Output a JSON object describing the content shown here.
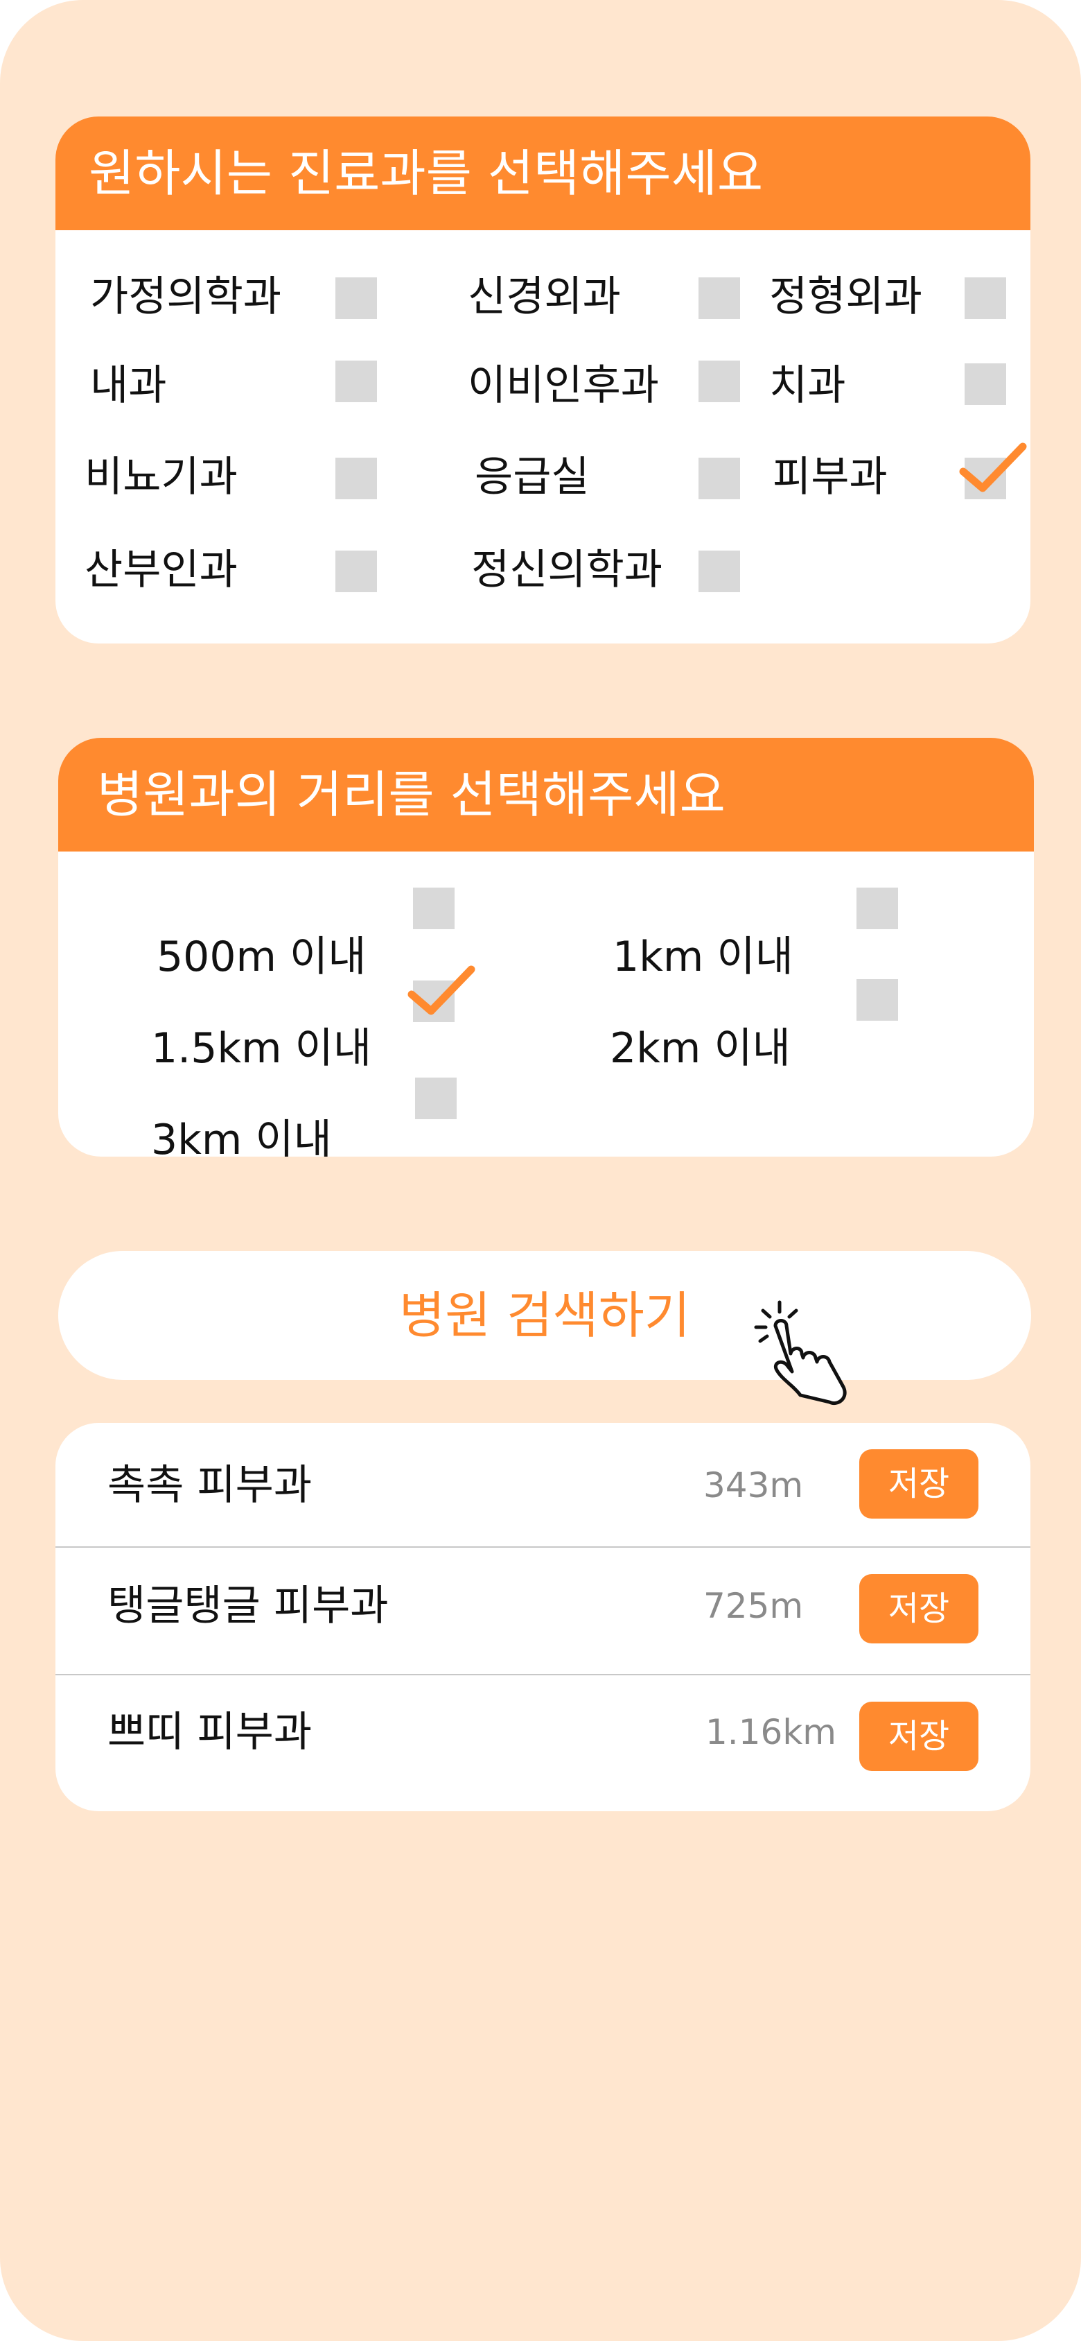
{
  "colors": {
    "accent": "#ff8a2f",
    "background": "#ffe6cf",
    "checkbox": "#d9d9d9"
  },
  "department": {
    "title": "원하시는 진료과를 선택해주세요",
    "options": [
      {
        "label": "가정의학과",
        "checked": false
      },
      {
        "label": "신경외과",
        "checked": false
      },
      {
        "label": "정형외과",
        "checked": false
      },
      {
        "label": "내과",
        "checked": false
      },
      {
        "label": "이비인후과",
        "checked": false
      },
      {
        "label": "치과",
        "checked": false
      },
      {
        "label": "비뇨기과",
        "checked": false
      },
      {
        "label": "응급실",
        "checked": false
      },
      {
        "label": "피부과",
        "checked": true
      },
      {
        "label": "산부인과",
        "checked": false
      },
      {
        "label": "정신의학과",
        "checked": false
      }
    ]
  },
  "distance": {
    "title": "병원과의 거리를 선택해주세요",
    "options": [
      {
        "label": "500m 이내",
        "checked": false
      },
      {
        "label": "1km 이내",
        "checked": false
      },
      {
        "label": "1.5km 이내",
        "checked": true
      },
      {
        "label": "2km 이내",
        "checked": false
      },
      {
        "label": "3km 이내",
        "checked": false
      }
    ]
  },
  "search": {
    "label": "병원 검색하기",
    "icon": "tap-hand-icon"
  },
  "results": [
    {
      "name": "촉촉 피부과",
      "distance": "343m",
      "save_label": "저장"
    },
    {
      "name": "탱글탱글 피부과",
      "distance": "725m",
      "save_label": "저장"
    },
    {
      "name": "쁘띠 피부과",
      "distance": "1.16km",
      "save_label": "저장"
    }
  ]
}
